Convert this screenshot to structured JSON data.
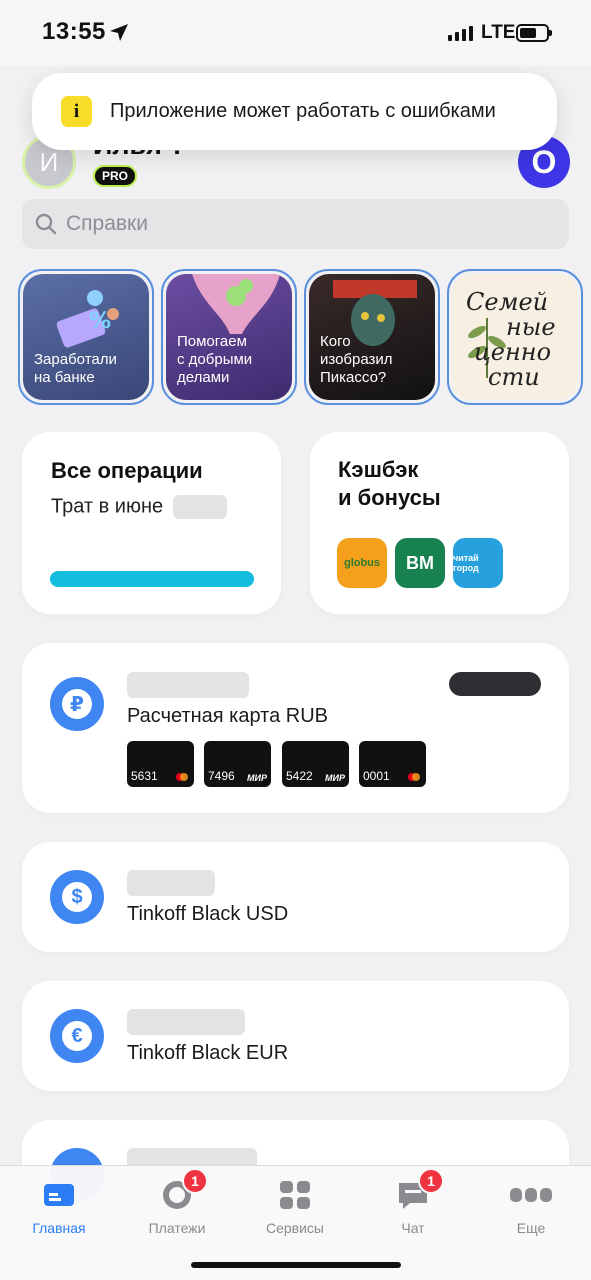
{
  "status_bar": {
    "time": "13:55",
    "network": "LTE"
  },
  "toast": {
    "icon_char": "i",
    "text": "Приложение может работать с ошибками"
  },
  "header": {
    "avatar_initial": "И",
    "name": "Илья ?",
    "badge": "PRO",
    "app_icon_letter": "O"
  },
  "search": {
    "placeholder": "Справки"
  },
  "stories": [
    {
      "label_line1": "Заработали",
      "label_line2": "на банке",
      "label_line3": ""
    },
    {
      "label_line1": "Помогаем",
      "label_line2": "с добрыми",
      "label_line3": "делами"
    },
    {
      "label_line1": "Кого",
      "label_line2": "изобразил",
      "label_line3": "Пикассо?"
    },
    {
      "script_line1": "Семей",
      "script_line2": "ные",
      "script_line3": "ценно",
      "script_line4": "сти"
    }
  ],
  "operations_card": {
    "title": "Все операции",
    "subtitle": "Трат в июне"
  },
  "cashback_card": {
    "title_line1": "Кэшбэк",
    "title_line2": "и бонусы",
    "partners": [
      {
        "name": "globus"
      },
      {
        "name": "ВМ"
      },
      {
        "name": "читай город"
      }
    ]
  },
  "accounts": [
    {
      "title": "Расчетная карта RUB",
      "symbol": "₽",
      "cards": [
        {
          "last4": "5631",
          "network": "mastercard"
        },
        {
          "last4": "7496",
          "network": "МИР"
        },
        {
          "last4": "5422",
          "network": "МИР"
        },
        {
          "last4": "0001",
          "network": "mastercard"
        }
      ]
    },
    {
      "title": "Tinkoff Black USD",
      "symbol": "$"
    },
    {
      "title": "Tinkoff Black EUR",
      "symbol": "€"
    },
    {
      "title": "",
      "symbol": ""
    }
  ],
  "tabbar": {
    "tabs": [
      {
        "label": "Главная",
        "badge": ""
      },
      {
        "label": "Платежи",
        "badge": "1"
      },
      {
        "label": "Сервисы",
        "badge": ""
      },
      {
        "label": "Чат",
        "badge": "1"
      },
      {
        "label": "Еще",
        "badge": ""
      }
    ],
    "active_color": "#2a7df4"
  }
}
